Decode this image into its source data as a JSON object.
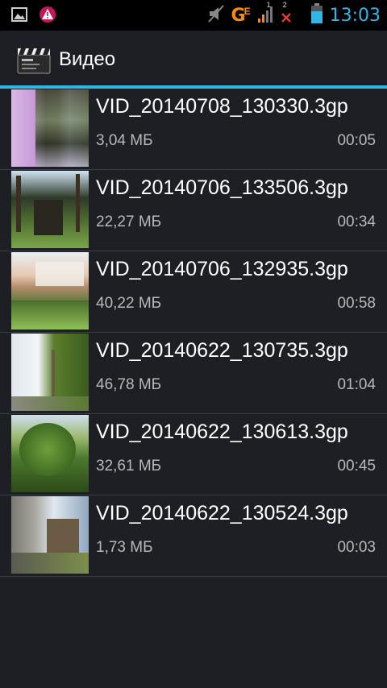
{
  "status_bar": {
    "icons_left": [
      "image-icon",
      "warning-icon"
    ],
    "network_label": "G",
    "network_sub": "E",
    "sim1": "1",
    "sim2": "2",
    "time": "13:03",
    "colors": {
      "time": "#33b5e5",
      "network": "#ff8a00",
      "no_signal": "#e53935"
    }
  },
  "action_bar": {
    "title": "Видео",
    "icon": "clapperboard-icon",
    "accent": "#33b5e5"
  },
  "videos": [
    {
      "name": "VID_20140708_130330.3gp",
      "size": "3,04 МБ",
      "duration": "00:05"
    },
    {
      "name": "VID_20140706_133506.3gp",
      "size": "22,27 МБ",
      "duration": "00:34"
    },
    {
      "name": "VID_20140706_132935.3gp",
      "size": "40,22 МБ",
      "duration": "00:58"
    },
    {
      "name": "VID_20140622_130735.3gp",
      "size": "46,78 МБ",
      "duration": "01:04"
    },
    {
      "name": "VID_20140622_130613.3gp",
      "size": "32,61 МБ",
      "duration": "00:45"
    },
    {
      "name": "VID_20140622_130524.3gp",
      "size": "1,73 МБ",
      "duration": "00:03"
    }
  ]
}
